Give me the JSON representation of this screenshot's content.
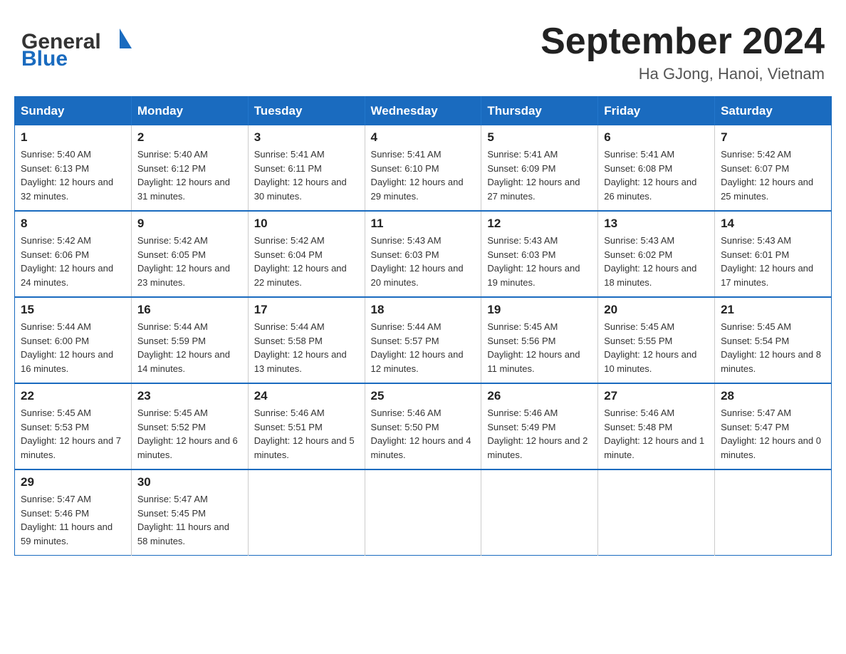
{
  "header": {
    "logo_general": "General",
    "logo_blue": "Blue",
    "month_title": "September 2024",
    "location": "Ha GJong, Hanoi, Vietnam"
  },
  "weekdays": [
    "Sunday",
    "Monday",
    "Tuesday",
    "Wednesday",
    "Thursday",
    "Friday",
    "Saturday"
  ],
  "weeks": [
    [
      {
        "day": "1",
        "sunrise": "5:40 AM",
        "sunset": "6:13 PM",
        "daylight": "12 hours and 32 minutes."
      },
      {
        "day": "2",
        "sunrise": "5:40 AM",
        "sunset": "6:12 PM",
        "daylight": "12 hours and 31 minutes."
      },
      {
        "day": "3",
        "sunrise": "5:41 AM",
        "sunset": "6:11 PM",
        "daylight": "12 hours and 30 minutes."
      },
      {
        "day": "4",
        "sunrise": "5:41 AM",
        "sunset": "6:10 PM",
        "daylight": "12 hours and 29 minutes."
      },
      {
        "day": "5",
        "sunrise": "5:41 AM",
        "sunset": "6:09 PM",
        "daylight": "12 hours and 27 minutes."
      },
      {
        "day": "6",
        "sunrise": "5:41 AM",
        "sunset": "6:08 PM",
        "daylight": "12 hours and 26 minutes."
      },
      {
        "day": "7",
        "sunrise": "5:42 AM",
        "sunset": "6:07 PM",
        "daylight": "12 hours and 25 minutes."
      }
    ],
    [
      {
        "day": "8",
        "sunrise": "5:42 AM",
        "sunset": "6:06 PM",
        "daylight": "12 hours and 24 minutes."
      },
      {
        "day": "9",
        "sunrise": "5:42 AM",
        "sunset": "6:05 PM",
        "daylight": "12 hours and 23 minutes."
      },
      {
        "day": "10",
        "sunrise": "5:42 AM",
        "sunset": "6:04 PM",
        "daylight": "12 hours and 22 minutes."
      },
      {
        "day": "11",
        "sunrise": "5:43 AM",
        "sunset": "6:03 PM",
        "daylight": "12 hours and 20 minutes."
      },
      {
        "day": "12",
        "sunrise": "5:43 AM",
        "sunset": "6:03 PM",
        "daylight": "12 hours and 19 minutes."
      },
      {
        "day": "13",
        "sunrise": "5:43 AM",
        "sunset": "6:02 PM",
        "daylight": "12 hours and 18 minutes."
      },
      {
        "day": "14",
        "sunrise": "5:43 AM",
        "sunset": "6:01 PM",
        "daylight": "12 hours and 17 minutes."
      }
    ],
    [
      {
        "day": "15",
        "sunrise": "5:44 AM",
        "sunset": "6:00 PM",
        "daylight": "12 hours and 16 minutes."
      },
      {
        "day": "16",
        "sunrise": "5:44 AM",
        "sunset": "5:59 PM",
        "daylight": "12 hours and 14 minutes."
      },
      {
        "day": "17",
        "sunrise": "5:44 AM",
        "sunset": "5:58 PM",
        "daylight": "12 hours and 13 minutes."
      },
      {
        "day": "18",
        "sunrise": "5:44 AM",
        "sunset": "5:57 PM",
        "daylight": "12 hours and 12 minutes."
      },
      {
        "day": "19",
        "sunrise": "5:45 AM",
        "sunset": "5:56 PM",
        "daylight": "12 hours and 11 minutes."
      },
      {
        "day": "20",
        "sunrise": "5:45 AM",
        "sunset": "5:55 PM",
        "daylight": "12 hours and 10 minutes."
      },
      {
        "day": "21",
        "sunrise": "5:45 AM",
        "sunset": "5:54 PM",
        "daylight": "12 hours and 8 minutes."
      }
    ],
    [
      {
        "day": "22",
        "sunrise": "5:45 AM",
        "sunset": "5:53 PM",
        "daylight": "12 hours and 7 minutes."
      },
      {
        "day": "23",
        "sunrise": "5:45 AM",
        "sunset": "5:52 PM",
        "daylight": "12 hours and 6 minutes."
      },
      {
        "day": "24",
        "sunrise": "5:46 AM",
        "sunset": "5:51 PM",
        "daylight": "12 hours and 5 minutes."
      },
      {
        "day": "25",
        "sunrise": "5:46 AM",
        "sunset": "5:50 PM",
        "daylight": "12 hours and 4 minutes."
      },
      {
        "day": "26",
        "sunrise": "5:46 AM",
        "sunset": "5:49 PM",
        "daylight": "12 hours and 2 minutes."
      },
      {
        "day": "27",
        "sunrise": "5:46 AM",
        "sunset": "5:48 PM",
        "daylight": "12 hours and 1 minute."
      },
      {
        "day": "28",
        "sunrise": "5:47 AM",
        "sunset": "5:47 PM",
        "daylight": "12 hours and 0 minutes."
      }
    ],
    [
      {
        "day": "29",
        "sunrise": "5:47 AM",
        "sunset": "5:46 PM",
        "daylight": "11 hours and 59 minutes."
      },
      {
        "day": "30",
        "sunrise": "5:47 AM",
        "sunset": "5:45 PM",
        "daylight": "11 hours and 58 minutes."
      },
      null,
      null,
      null,
      null,
      null
    ]
  ],
  "labels": {
    "sunrise_prefix": "Sunrise: ",
    "sunset_prefix": "Sunset: ",
    "daylight_prefix": "Daylight: "
  }
}
